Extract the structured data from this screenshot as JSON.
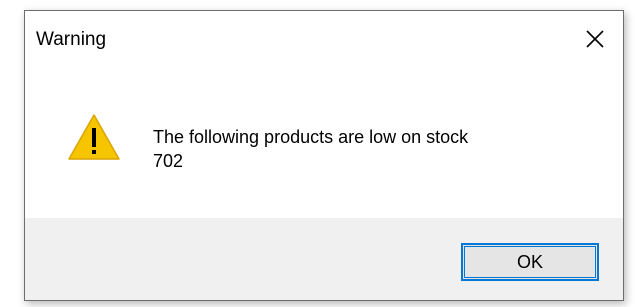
{
  "window": {
    "title": "Warning"
  },
  "titlebar": {
    "close_icon": "close-icon"
  },
  "message": {
    "line1": "The following products are low on stock",
    "line2": "702",
    "icon": "warning-icon"
  },
  "buttons": {
    "ok_label": "OK"
  },
  "colors": {
    "accent": "#0078d7",
    "warning_fill": "#f7c400",
    "footer_bg": "#f0f0f0"
  }
}
